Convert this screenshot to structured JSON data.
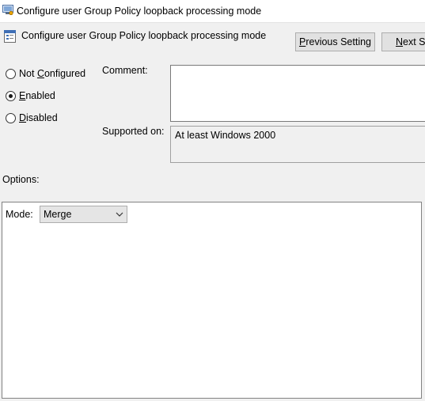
{
  "window": {
    "title": "Configure user Group Policy loopback processing mode"
  },
  "header": {
    "policy_name": "Configure user Group Policy loopback processing mode",
    "previous_button": {
      "mnemonic": "P",
      "rest": "revious Setting"
    },
    "next_button": {
      "mnemonic": "N",
      "rest": "ext Se"
    }
  },
  "state": {
    "options": [
      {
        "id": "not-configured",
        "pre": "Not ",
        "mnemonic": "C",
        "post": "onfigured",
        "selected": false
      },
      {
        "id": "enabled",
        "pre": "",
        "mnemonic": "E",
        "post": "nabled",
        "selected": true
      },
      {
        "id": "disabled",
        "pre": "",
        "mnemonic": "D",
        "post": "isabled",
        "selected": false
      }
    ]
  },
  "comment": {
    "label": "Comment:",
    "value": ""
  },
  "supported": {
    "label": "Supported on:",
    "value": "At least Windows 2000"
  },
  "options": {
    "label": "Options:",
    "mode_label": "Mode:",
    "mode_value": "Merge"
  },
  "colors": {
    "background": "#f0f0f0",
    "button_face": "#e1e1e1",
    "button_border": "#adadad"
  },
  "icons": {
    "window": "gpo-window-icon",
    "policy": "policy-setting-icon",
    "dropdown": "chevron-down-icon"
  }
}
